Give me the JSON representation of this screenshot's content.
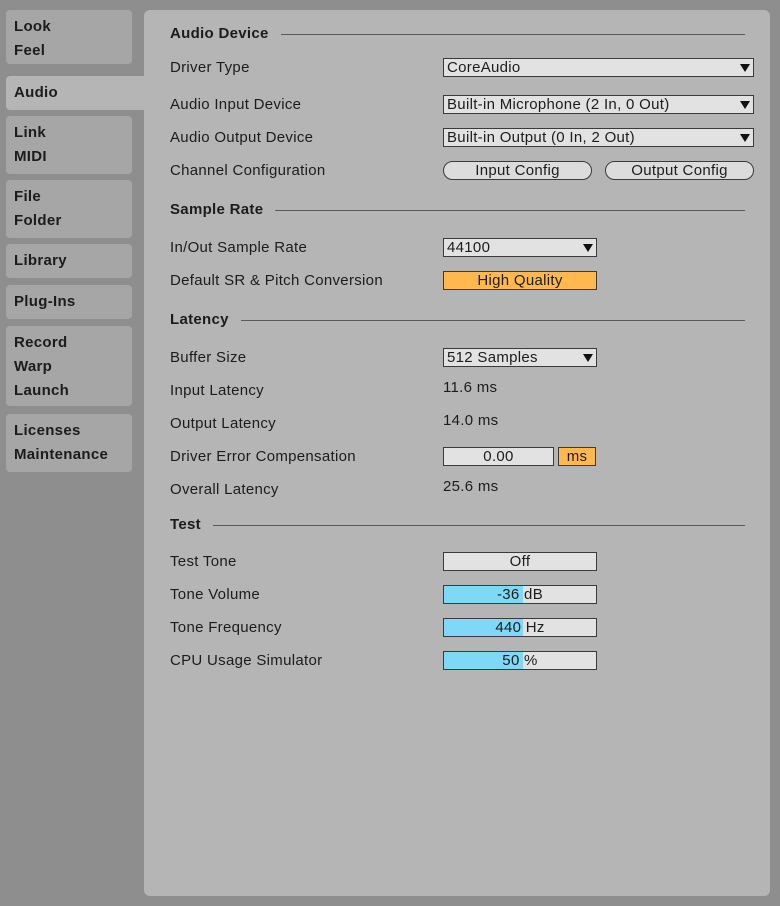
{
  "sidebar": {
    "tabs": [
      {
        "lines": [
          "Look",
          "Feel"
        ]
      },
      {
        "lines": [
          "Audio"
        ]
      },
      {
        "lines": [
          "Link",
          "MIDI"
        ]
      },
      {
        "lines": [
          "File",
          "Folder"
        ]
      },
      {
        "lines": [
          "Library"
        ]
      },
      {
        "lines": [
          "Plug-Ins"
        ]
      },
      {
        "lines": [
          "Record",
          "Warp",
          "Launch"
        ]
      },
      {
        "lines": [
          "Licenses",
          "Maintenance"
        ]
      }
    ],
    "active": "Audio"
  },
  "audio_device": {
    "heading": "Audio Device",
    "driver_type_label": "Driver Type",
    "driver_type_value": "CoreAudio",
    "input_device_label": "Audio Input Device",
    "input_device_value": "Built-in Microphone (2 In, 0 Out)",
    "output_device_label": "Audio Output Device",
    "output_device_value": "Built-in Output (0 In, 2 Out)",
    "channel_config_label": "Channel Configuration",
    "input_config_button": "Input Config",
    "output_config_button": "Output Config"
  },
  "sample_rate": {
    "heading": "Sample Rate",
    "rate_label": "In/Out Sample Rate",
    "rate_value": "44100",
    "conversion_label": "Default SR & Pitch Conversion",
    "conversion_value": "High Quality"
  },
  "latency": {
    "heading": "Latency",
    "buffer_label": "Buffer Size",
    "buffer_value": "512 Samples",
    "input_label": "Input Latency",
    "input_value": "11.6 ms",
    "output_label": "Output Latency",
    "output_value": "14.0 ms",
    "driver_error_label": "Driver Error Compensation",
    "driver_error_value": "0.00",
    "driver_error_unit": "ms",
    "overall_label": "Overall Latency",
    "overall_value": "25.6 ms"
  },
  "test": {
    "heading": "Test",
    "tone_label": "Test Tone",
    "tone_value": "Off",
    "volume_label": "Tone Volume",
    "volume_value": "-36 dB",
    "volume_fill_percent": 52,
    "frequency_label": "Tone Frequency",
    "frequency_value": "440 Hz",
    "frequency_fill_percent": 52,
    "cpu_label": "CPU Usage Simulator",
    "cpu_value": "50 %",
    "cpu_fill_percent": 52
  },
  "colors": {
    "highlight_orange": "#ffb84d",
    "slider_blue": "#7fd8f6"
  }
}
